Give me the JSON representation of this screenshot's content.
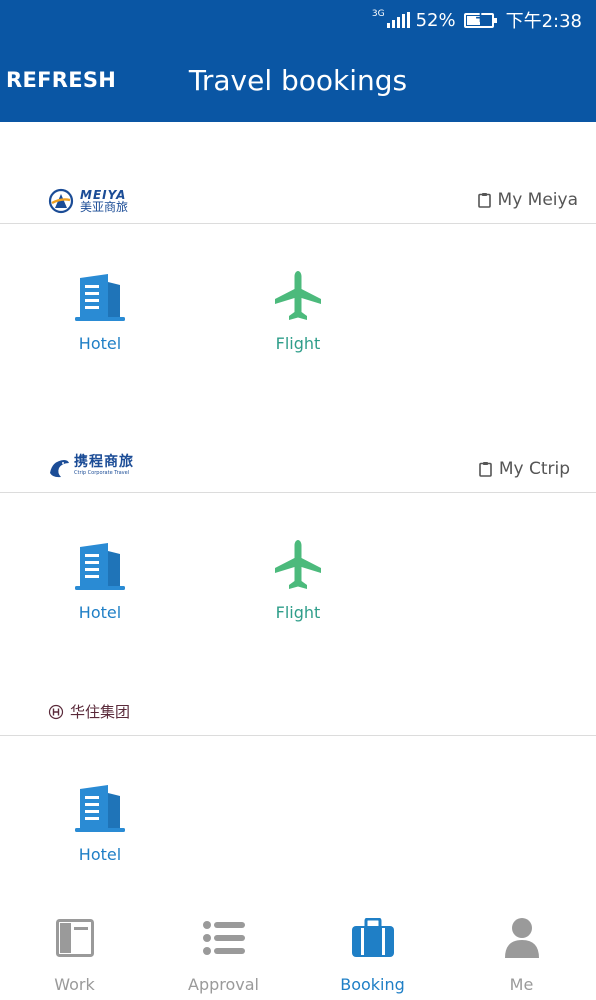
{
  "status_bar": {
    "network": "3G",
    "battery": "52%",
    "time": "下午2:38"
  },
  "header": {
    "refresh_label": "REFRESH",
    "title": "Travel bookings"
  },
  "sections": [
    {
      "brand_logo_text": "MEIYA",
      "brand_cn": "美亚商旅",
      "my_link": "My Meiya",
      "tiles": [
        {
          "label": "Hotel"
        },
        {
          "label": "Flight"
        }
      ]
    },
    {
      "brand_cn": "携程商旅",
      "brand_en": "Ctrip Corporate Travel",
      "my_link": "My Ctrip",
      "tiles": [
        {
          "label": "Hotel"
        },
        {
          "label": "Flight"
        }
      ]
    },
    {
      "brand_cn": "华住集团",
      "tiles": [
        {
          "label": "Hotel"
        }
      ]
    }
  ],
  "tabs": [
    {
      "label": "Work",
      "icon": "work-icon"
    },
    {
      "label": "Approval",
      "icon": "list-icon"
    },
    {
      "label": "Booking",
      "icon": "briefcase-icon",
      "active": true
    },
    {
      "label": "Me",
      "icon": "user-icon"
    }
  ],
  "colors": {
    "header_bg": "#0a56a4",
    "hotel_blue": "#2a8bd4",
    "flight_green": "#4cba7c",
    "active_tab": "#1f7fc6",
    "inactive_tab": "#9a9a9a"
  }
}
